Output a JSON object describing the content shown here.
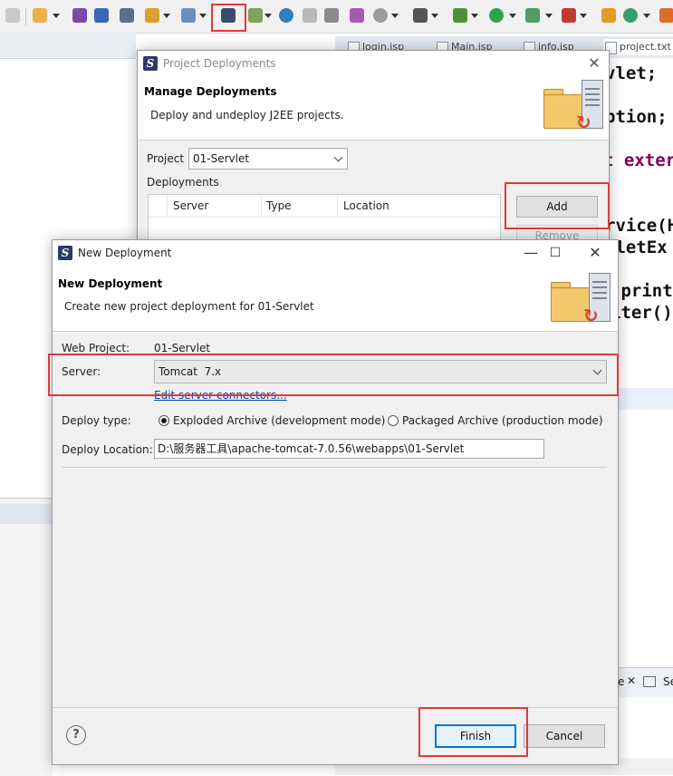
{
  "editor_tabs": [
    "login.jsp",
    "Main.jsp",
    "info.jsp",
    "project.txt"
  ],
  "code_lines": [
    "vlet;",
    "ption;",
    "t exter",
    "rvice(H",
    "vletEx",
    ".print",
    "iter()"
  ],
  "console_tabs": [
    "e",
    "Se"
  ],
  "project_deployments": {
    "window_title": "Project Deployments",
    "heading": "Manage Deployments",
    "description": "Deploy and undeploy J2EE projects.",
    "project_label": "Project",
    "project_value": "01-Servlet",
    "deployments_label": "Deployments",
    "columns": [
      "Server",
      "Type",
      "Location"
    ],
    "add_label": "Add",
    "remove_label": "Remove"
  },
  "new_deployment": {
    "window_title": "New Deployment",
    "heading": "New Deployment",
    "description": "Create new project deployment for 01-Servlet",
    "web_project_label": "Web Project:",
    "web_project_value": "01-Servlet",
    "server_label": "Server:",
    "server_value": "Tomcat  7.x",
    "edit_connectors_link": "Edit server connectors...",
    "deploy_type_label": "Deploy type:",
    "deploy_type_options": [
      "Exploded Archive (development mode)",
      "Packaged Archive (production mode)"
    ],
    "deploy_type_selected": 0,
    "deploy_location_label": "Deploy Location:",
    "deploy_location_value": "D:\\服务器工具\\apache-tomcat-7.0.56\\webapps\\01-Servlet",
    "help_glyph": "?",
    "finish_label": "Finish",
    "cancel_label": "Cancel",
    "minimize_glyph": "—",
    "maximize_glyph": "☐",
    "close_glyph": "✕"
  },
  "highlight_color": "#e0383b"
}
